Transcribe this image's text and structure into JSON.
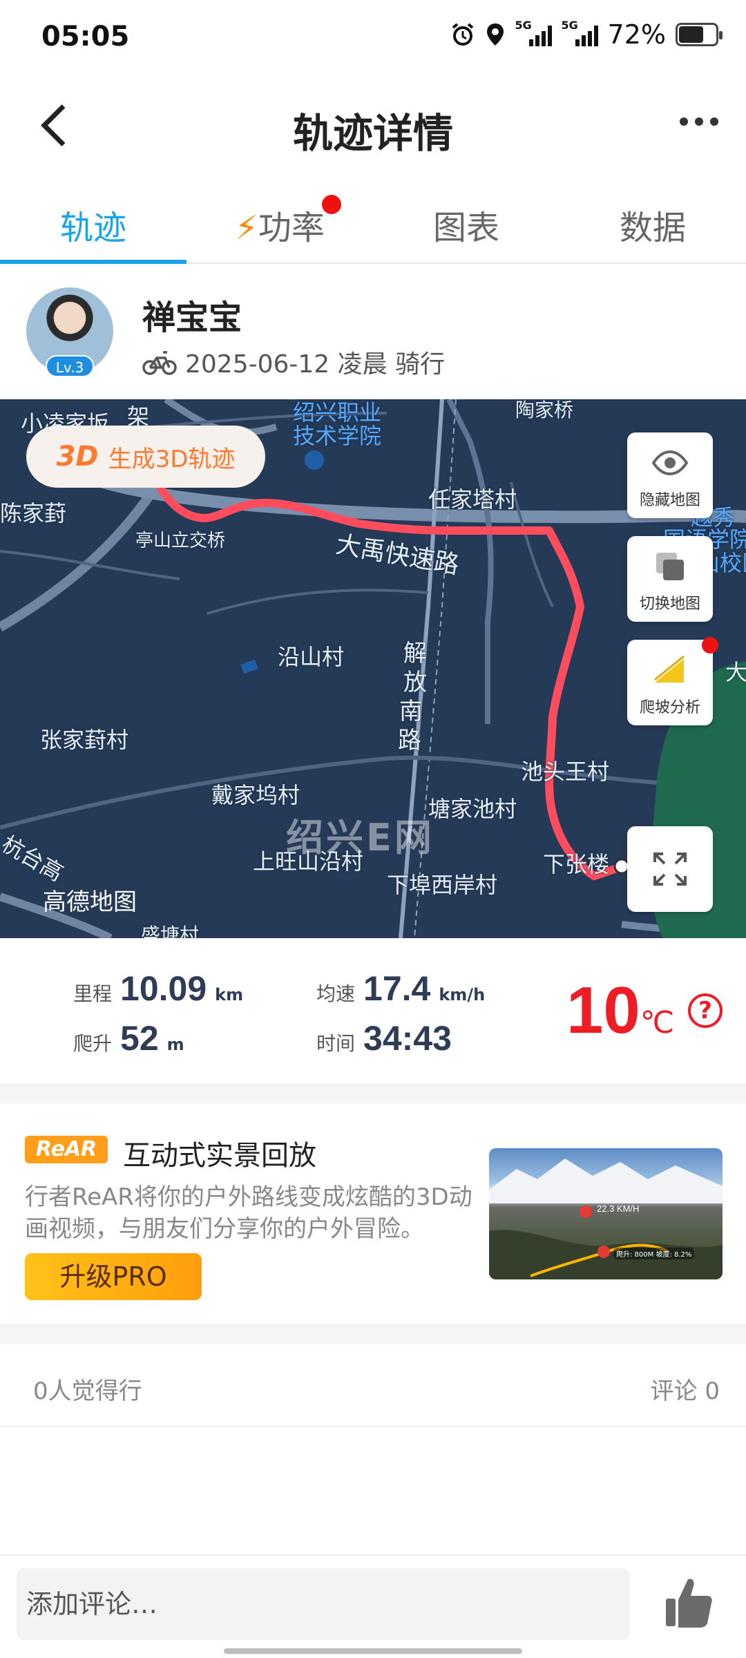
{
  "status_bar": {
    "time": "05:05",
    "network1": "5G",
    "network2": "5G",
    "battery": "72%",
    "battery_level": 0.72
  },
  "header": {
    "title": "轨迹详情"
  },
  "tabs": [
    {
      "label": "轨迹",
      "active": true
    },
    {
      "label": "功率",
      "badge": true
    },
    {
      "label": "图表"
    },
    {
      "label": "数据"
    }
  ],
  "user": {
    "name": "禅宝宝",
    "level": "Lv.3",
    "meta": "2025-06-12 凌晨 骑行"
  },
  "map": {
    "generate_3d_icon": "3D",
    "generate_3d_label": "生成3D轨迹",
    "hide_map": "隐藏地图",
    "switch_map": "切换地图",
    "climb_analysis": "爬坡分析",
    "watermark": "绍兴E网",
    "provider": "高德地图",
    "labels": {
      "l1": "小凌家坂",
      "l2": "架",
      "l3": "绍兴职业",
      "l4": "技术学院",
      "l5": "陶家桥",
      "l6": "陈家葑",
      "l7": "任家塔村",
      "l8": "越秀",
      "l9": "国语学院",
      "l10": "山校区",
      "l11": "亭山立交桥",
      "l12": "大禹快速路",
      "l13": "沿山村",
      "l14": "解",
      "l15": "放",
      "l16": "南",
      "l17": "路",
      "l18": "大",
      "l19": "张家葑村",
      "l20": "池头王村",
      "l21": "戴家坞村",
      "l22": "塘家池村",
      "l23": "上旺山沿村",
      "l24": "下张楼",
      "l25": "下埠西岸村",
      "l26": "杭台高",
      "l27": "盛塘村"
    }
  },
  "stats": {
    "distance_label": "里程",
    "distance": "10.09",
    "distance_unit": "km",
    "speed_label": "均速",
    "speed": "17.4",
    "speed_unit": "km/h",
    "climb_label": "爬升",
    "climb": "52",
    "climb_unit": "m",
    "time_label": "时间",
    "time": "34:43",
    "temperature": "10",
    "temperature_unit": "℃"
  },
  "promo": {
    "badge": "ReAR",
    "title": "互动式实景回放",
    "description": "行者ReAR将你的户外路线变成炫酷的3D动画视频，与朋友们分享你的户外冒险。",
    "button": "升级PRO",
    "thumb_speed": "22.3 KM/H",
    "thumb_climb": "爬升: 800M",
    "thumb_grade": "坡度: 8.2%"
  },
  "social": {
    "likes": "0人觉得行",
    "comments": "评论 0"
  },
  "comment_bar": {
    "placeholder": "添加评论…"
  },
  "colors": {
    "accent": "#1aa3e8",
    "route": "#ff4d5e",
    "temp": "#ee1c25",
    "map_bg": "#243a57"
  }
}
